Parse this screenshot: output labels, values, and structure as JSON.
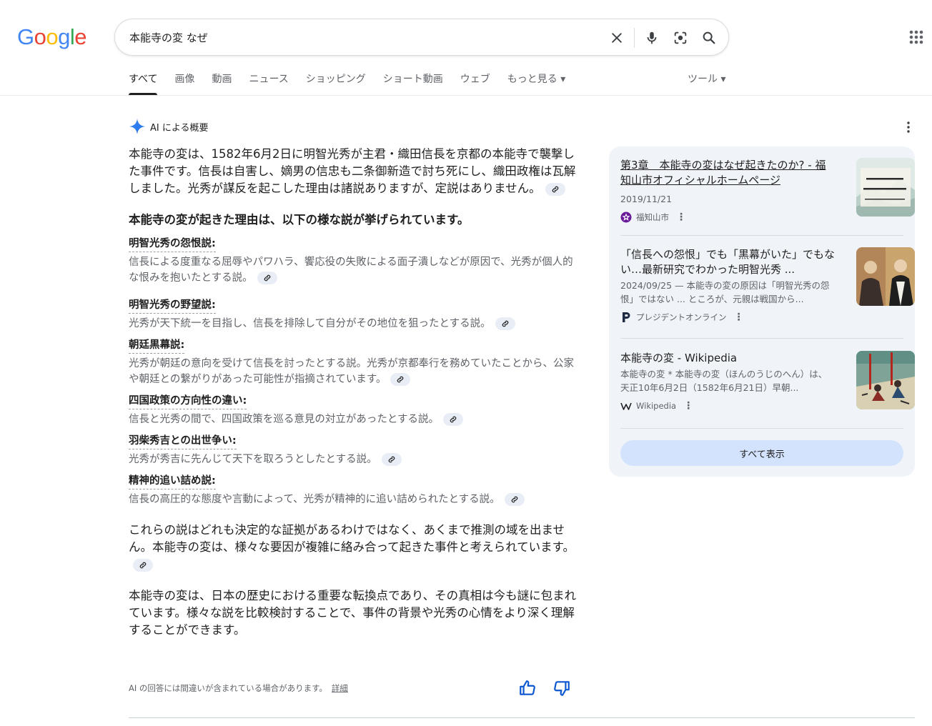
{
  "header": {
    "logo_letters": [
      "G",
      "o",
      "o",
      "g",
      "l",
      "e"
    ],
    "logo_colors": [
      "#4285F4",
      "#EA4335",
      "#FBBC05",
      "#4285F4",
      "#34A853",
      "#EA4335"
    ],
    "search_query": "本能寺の変 なぜ"
  },
  "tabs": [
    {
      "label": "すべて",
      "active": true
    },
    {
      "label": "画像"
    },
    {
      "label": "動画"
    },
    {
      "label": "ニュース"
    },
    {
      "label": "ショッピング"
    },
    {
      "label": "ショート動画"
    },
    {
      "label": "ウェブ"
    },
    {
      "label": "もっと見る ▾"
    }
  ],
  "tools_label": "ツール ▾",
  "ai_overview": {
    "heading": "AI による概要",
    "intro": "本能寺の変は、1582年6月2日に明智光秀が主君・織田信長を京都の本能寺で襲撃した事件です。信長は自害し、嫡男の信忠も二条御新造で討ち死にし、織田政権は瓦解しました。光秀が謀反を起こした理由は諸説ありますが、定説はありません。",
    "subheading": "本能寺の変が起きた理由は、以下の様な説が挙げられています。",
    "items": [
      {
        "title": "明智光秀の怨恨説:",
        "desc": "信長による度重なる屈辱やパワハラ、饗応役の失敗による面子潰しなどが原因で、光秀が個人的な恨みを抱いたとする説。"
      },
      {
        "title": "明智光秀の野望説:",
        "desc": "光秀が天下統一を目指し、信長を排除して自分がその地位を狙ったとする説。"
      },
      {
        "title": "朝廷黒幕説:",
        "desc": "光秀が朝廷の意向を受けて信長を討ったとする説。光秀が京都奉行を務めていたことから、公家や朝廷との繋がりがあった可能性が指摘されています。"
      },
      {
        "title": "四国政策の方向性の違い:",
        "desc": "信長と光秀の間で、四国政策を巡る意見の対立があったとする説。"
      },
      {
        "title": "羽柴秀吉との出世争い:",
        "desc": "光秀が秀吉に先んじて天下を取ろうとしたとする説。"
      },
      {
        "title": "精神的追い詰め説:",
        "desc": "信長の高圧的な態度や言動によって、光秀が精神的に追い詰められたとする説。"
      }
    ],
    "para2": "これらの説はどれも決定的な証拠があるわけではなく、あくまで推測の域を出ません。本能寺の変は、様々な要因が複雑に絡み合って起きた事件と考えられています。",
    "para3": "本能寺の変は、日本の歴史における重要な転換点であり、その真相は今も謎に包まれています。様々な説を比較検討することで、事件の背景や光秀の心情をより深く理解することができます。",
    "disclaimer": "AI の回答には間違いが含まれている場合があります。",
    "details_link": "詳細"
  },
  "sources": [
    {
      "title": "第3章　本能寺の変はなぜ起きたのか? - 福知山市オフィシャルホームページ",
      "desc": "2019/11/21",
      "site": "福知山市"
    },
    {
      "title": "「信長への怨恨」でも「黒幕がいた」でもない…最新研究でわかった明智光秀 ...",
      "desc": "2024/09/25 — 本能寺の変の原因は「明智光秀の怨恨」ではない ... ところが、元親は戦国から...",
      "site": "プレジデントオンライン"
    },
    {
      "title": "本能寺の変 - Wikipedia",
      "desc": "本能寺の変 * 本能寺の変（ほんのうじのへん）は、天正10年6月2日（1582年6月21日）早朝...",
      "site": "Wikipedia"
    }
  ],
  "show_all": "すべて表示"
}
